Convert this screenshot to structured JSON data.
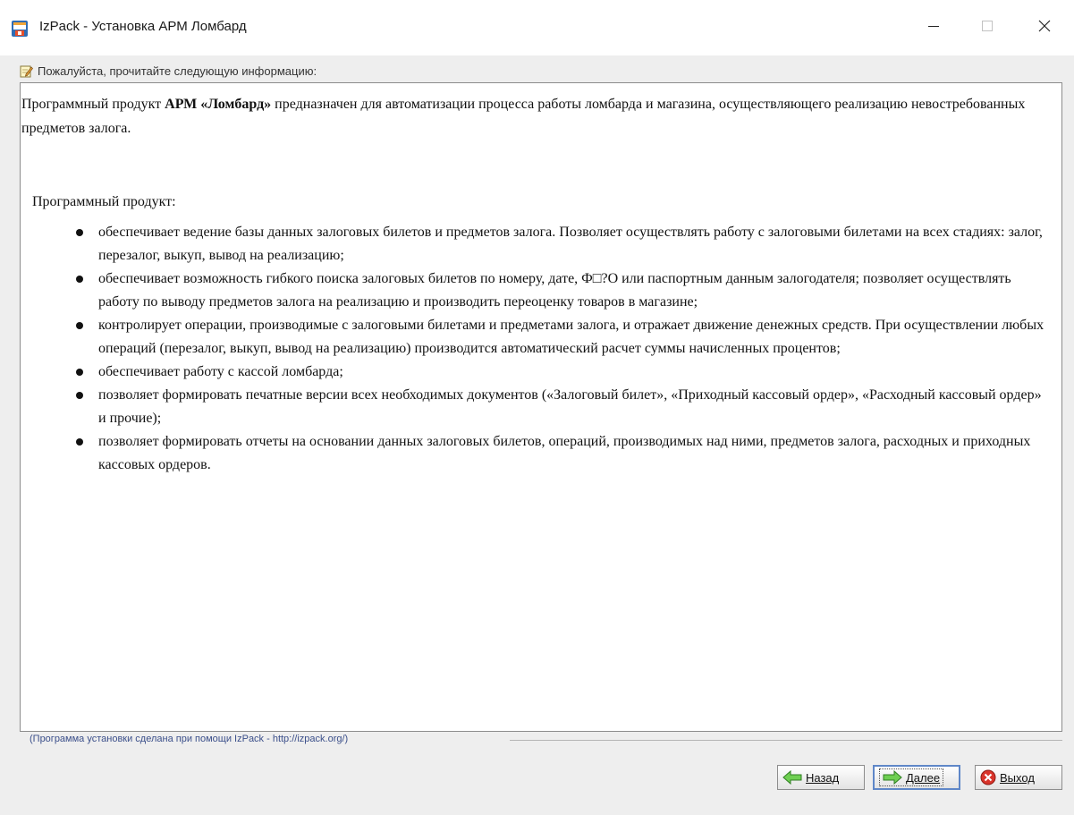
{
  "window": {
    "title": "IzPack - Установка  АРМ Ломбард",
    "icon": "izpack-installer-icon",
    "controls": {
      "minimize": "minimize-icon",
      "maximize": "maximize-icon",
      "close": "close-icon"
    }
  },
  "panel": {
    "label": "Пожалуйста, прочитайте следующую информацию:",
    "label_icon": "note-pencil-icon",
    "intro": {
      "prefix": "Программный продукт ",
      "bold": "АРМ «Ломбард»",
      "suffix": " предназначен для автоматизации процесса работы ломбарда и магазина, осуществляющего реализацию невостребованных предметов залога."
    },
    "heading": "Программный продукт:",
    "bullets": [
      "обеспечивает ведение базы данных залоговых билетов и предметов залога. Позволяет осуществлять работу с залоговыми билетами на всех стадиях: залог, перезалог, выкуп, вывод на реализацию;",
      "обеспечивает возможность гибкого поиска залоговых билетов по номеру, дате, Ф□?О или паспортным данным залогодателя; позволяет осуществлять работу по выводу предметов залога на реализацию и производить переоценку товаров в магазине;",
      "контролирует операции, производимые с залоговыми билетами и предметами залога, и отражает движение денежных средств. При осуществлении любых операций (перезалог, выкуп, вывод на реализацию) производится автоматический расчет суммы начисленных процентов;",
      "обеспечивает работу с кассой ломбарда;",
      "позволяет формировать печатные версии всех необходимых документов («Залоговый билет», «Приходный кассовый ордер», «Расходный кассовый ордер» и прочие);",
      "позволяет формировать отчеты на основании данных залоговых билетов, операций, производимых над ними, предметов залога, расходных и приходных кассовых ордеров."
    ]
  },
  "footer": {
    "credits": "(Программа установки сделана при помощи IzPack - http://izpack.org/)",
    "buttons": {
      "back": {
        "label": "Назад",
        "icon": "arrow-left-icon"
      },
      "next": {
        "label": "Далее",
        "icon": "arrow-right-icon"
      },
      "exit": {
        "label": "Выход",
        "icon": "close-circle-icon"
      }
    }
  },
  "colors": {
    "background": "#eeeeee",
    "panel_border": "#8c8c8c",
    "credits_text": "#3b4f8a",
    "default_button_border": "#5f87c8",
    "arrow_green": "#4caf3c",
    "exit_red": "#d9342b"
  }
}
